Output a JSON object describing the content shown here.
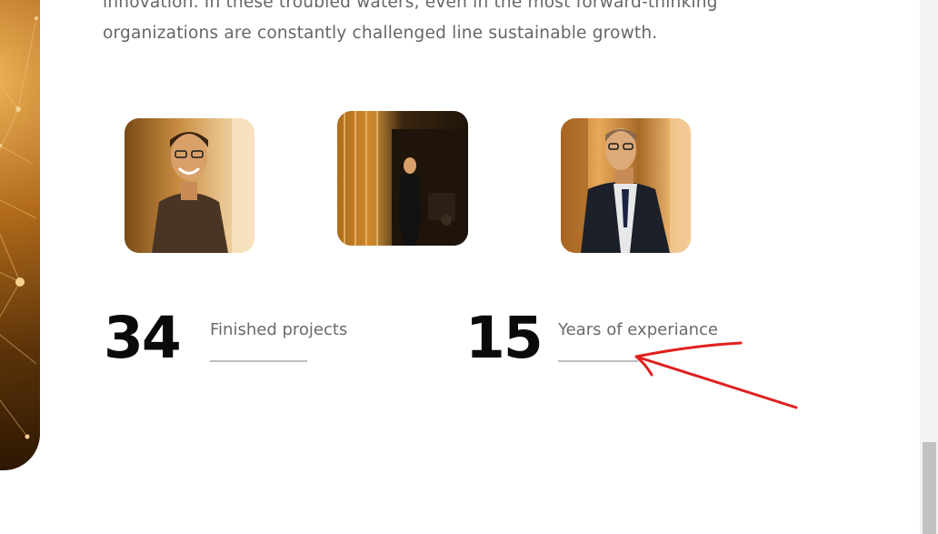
{
  "intro": {
    "line_1": "innovation. In these troubled waters, even in the most forward-thinking",
    "line_2": "organizations are constantly challenged line sustainable growth."
  },
  "photos": [
    {
      "alt": "smiling man in shirt with glasses"
    },
    {
      "alt": "woman walking in office corridor"
    },
    {
      "alt": "man in suit with glasses"
    }
  ],
  "stats": [
    {
      "number": "34",
      "label": "Finished projects"
    },
    {
      "number": "15",
      "label": "Years of experiance"
    }
  ],
  "annotation": {
    "color": "#e0201f",
    "shape": "arrow"
  },
  "colors": {
    "accent": "#c7822e",
    "heading": "#0a0a0a",
    "text": "#666666"
  }
}
